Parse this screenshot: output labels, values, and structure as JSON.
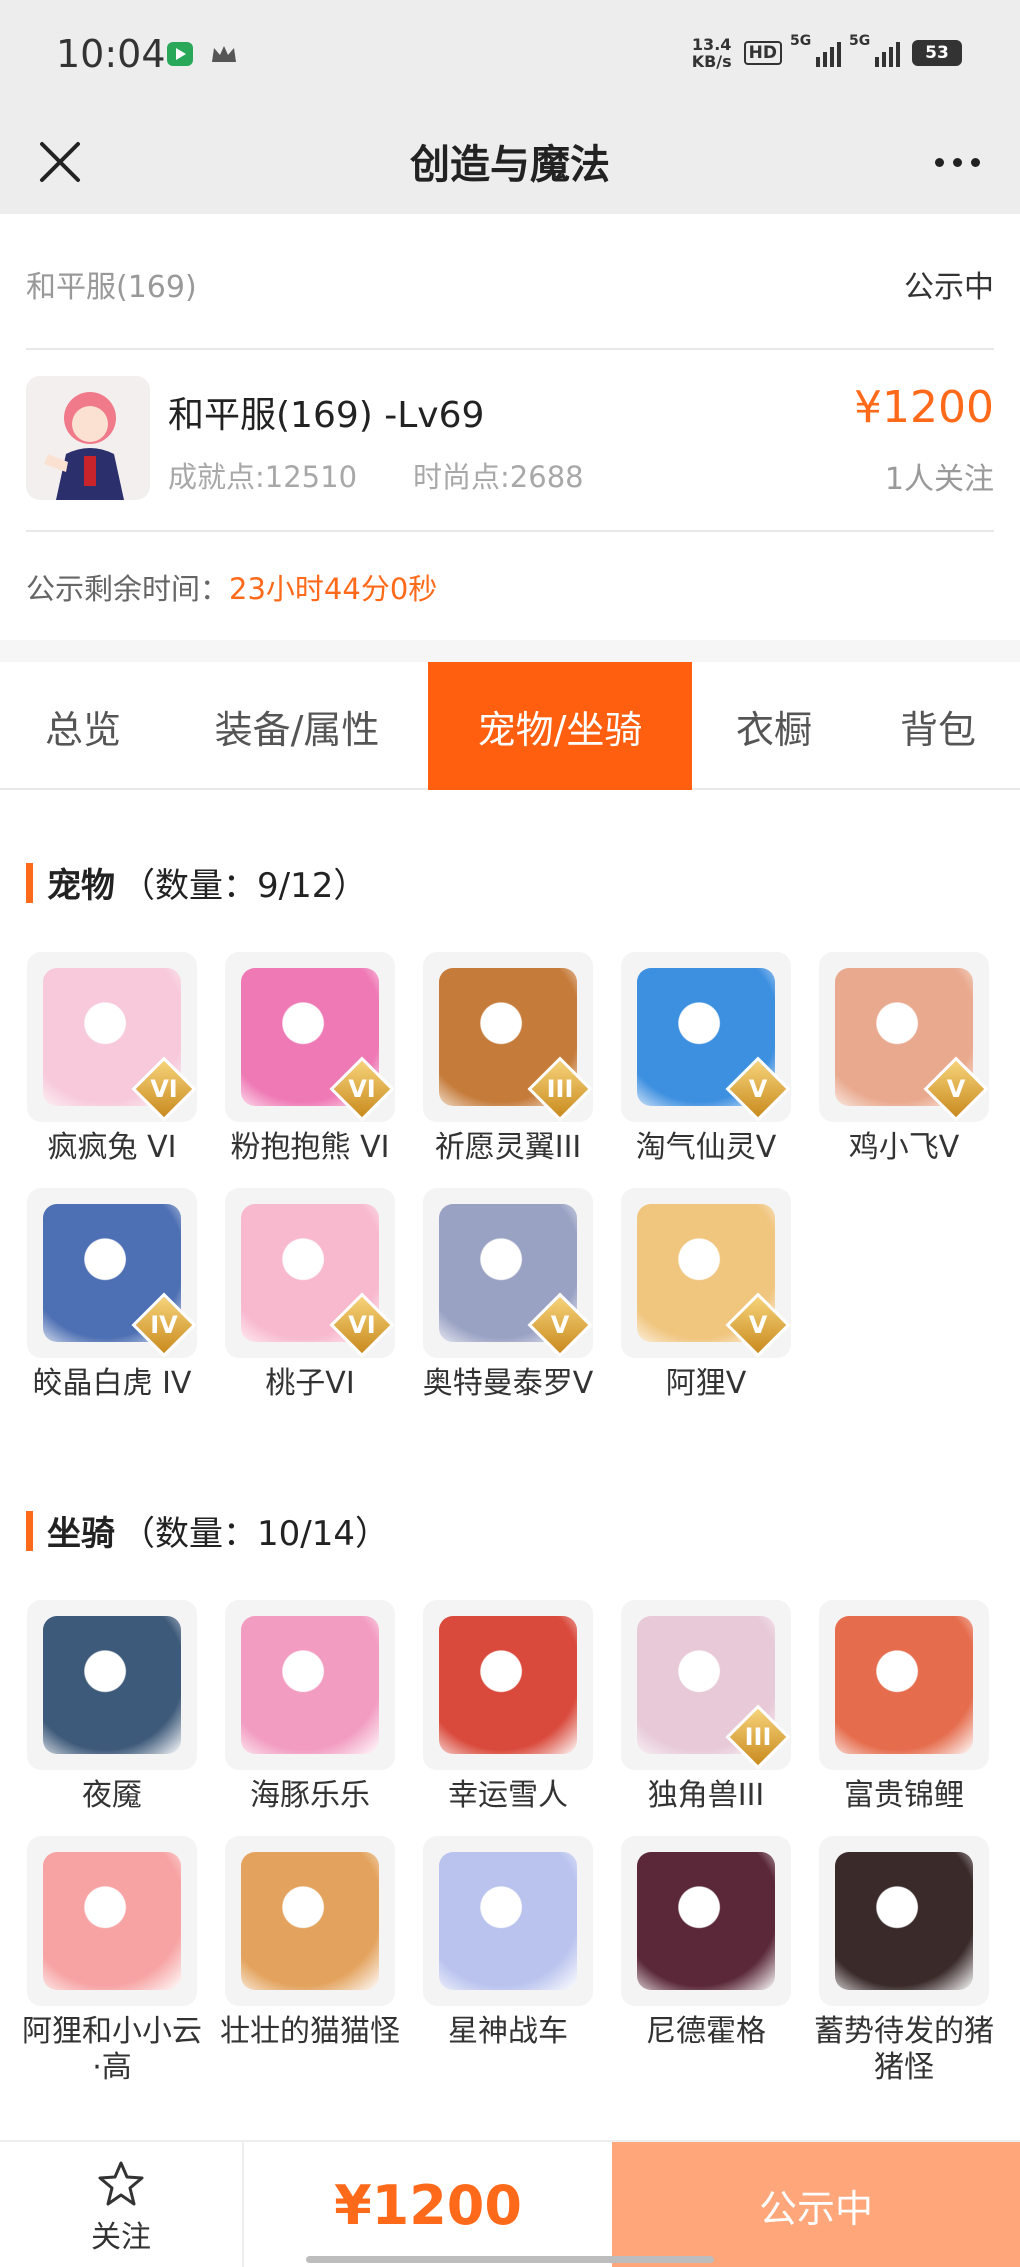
{
  "status_bar": {
    "time": "10:04",
    "net_speed_value": "13.4",
    "net_speed_unit": "KB/s",
    "hd": "HD",
    "signal1": "5G",
    "signal2": "5G",
    "battery": "53"
  },
  "nav": {
    "title": "创造与魔法"
  },
  "header": {
    "server": "和平服(169)",
    "status": "公示中",
    "role_title": "和平服(169) -Lv69",
    "achievement": "成就点:12510",
    "fashion": "时尚点:2688",
    "price": "¥1200",
    "watchers": "1人关注",
    "remain_label": "公示剩余时间：",
    "remain_value": "23小时44分0秒"
  },
  "tabs": [
    "总览",
    "装备/属性",
    "宠物/坐骑",
    "衣橱",
    "背包"
  ],
  "active_tab": 2,
  "pets": {
    "title": "宠物",
    "count": "（数量：9/12）",
    "items": [
      {
        "label": "疯疯兔 VI",
        "grade": "VI",
        "color": "#f7c9da"
      },
      {
        "label": "粉抱抱熊 VI",
        "grade": "VI",
        "color": "#ef79b5"
      },
      {
        "label": "祈愿灵翼III",
        "grade": "III",
        "color": "#c57b3a"
      },
      {
        "label": "淘气仙灵V",
        "grade": "V",
        "color": "#3d8fe0"
      },
      {
        "label": "鸡小飞V",
        "grade": "V",
        "color": "#e9a98e"
      },
      {
        "label": "皎晶白虎 IV",
        "grade": "IV",
        "color": "#4d6fb3"
      },
      {
        "label": "桃子VI",
        "grade": "VI",
        "color": "#f8b9cf"
      },
      {
        "label": "奥特曼泰罗V",
        "grade": "V",
        "color": "#9aa2c4"
      },
      {
        "label": "阿狸V",
        "grade": "V",
        "color": "#f0c57e"
      }
    ]
  },
  "mounts": {
    "title": "坐骑",
    "count": "（数量：10/14）",
    "items": [
      {
        "label": "夜魇",
        "color": "#3e5a7a"
      },
      {
        "label": "海豚乐乐",
        "color": "#f29cc1"
      },
      {
        "label": "幸运雪人",
        "color": "#d94a3c"
      },
      {
        "label": "独角兽III",
        "grade": "III",
        "color": "#e7c9d8"
      },
      {
        "label": "富贵锦鲤",
        "color": "#e56c4d"
      },
      {
        "label": "阿狸和小小云·高",
        "color": "#f7a3a3"
      },
      {
        "label": "壮壮的猫猫怪",
        "color": "#e3a35e"
      },
      {
        "label": "星神战车",
        "color": "#b9c3ee"
      },
      {
        "label": "尼德霍格",
        "color": "#5a2838"
      },
      {
        "label": "蓄势待发的猪猪怪",
        "color": "#3a2a2a"
      }
    ]
  },
  "bottom": {
    "follow": "关注",
    "price": "¥1200",
    "status": "公示中"
  }
}
